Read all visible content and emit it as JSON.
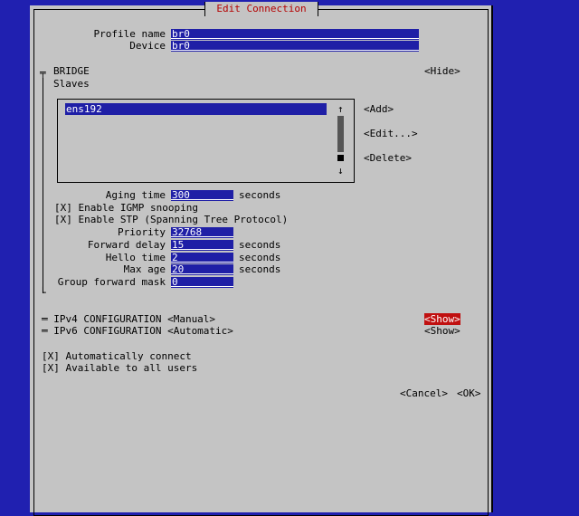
{
  "dialog": {
    "title": "Edit Connection"
  },
  "profile": {
    "profile_name_label": "Profile name",
    "profile_name_value": "br0",
    "device_label": "Device",
    "device_value": "br0"
  },
  "bridge": {
    "section_marker": "╤",
    "section_title": "BRIDGE",
    "hide_button": "<Hide>",
    "slaves_label": "Slaves",
    "slaves": [
      "ens192"
    ],
    "scroll_up": "↑",
    "scroll_down": "↓",
    "add_button": "<Add>",
    "edit_button": "<Edit...>",
    "delete_button": "<Delete>",
    "aging_time_label": "Aging time",
    "aging_time_value": "300",
    "aging_time_unit": "seconds",
    "igmp_checkbox": "[X] Enable IGMP snooping",
    "stp_checkbox": "[X] Enable STP (Spanning Tree Protocol)",
    "priority_label": "Priority",
    "priority_value": "32768",
    "forward_delay_label": "Forward delay",
    "forward_delay_value": "15",
    "forward_delay_unit": "seconds",
    "hello_time_label": "Hello time",
    "hello_time_value": "2",
    "hello_time_unit": "seconds",
    "max_age_label": "Max age",
    "max_age_value": "20",
    "max_age_unit": "seconds",
    "group_forward_mask_label": "Group forward mask",
    "group_forward_mask_value": "0",
    "section_end_marker": "└"
  },
  "ipv4": {
    "label": "═ IPv4 CONFIGURATION <Manual>",
    "show_button": "<Show>"
  },
  "ipv6": {
    "label": "═ IPv6 CONFIGURATION <Automatic>",
    "show_button": "<Show>"
  },
  "options": {
    "auto_connect": "[X] Automatically connect",
    "all_users": "[X] Available to all users"
  },
  "footer": {
    "cancel_button": "<Cancel>",
    "ok_button": "<OK>"
  }
}
